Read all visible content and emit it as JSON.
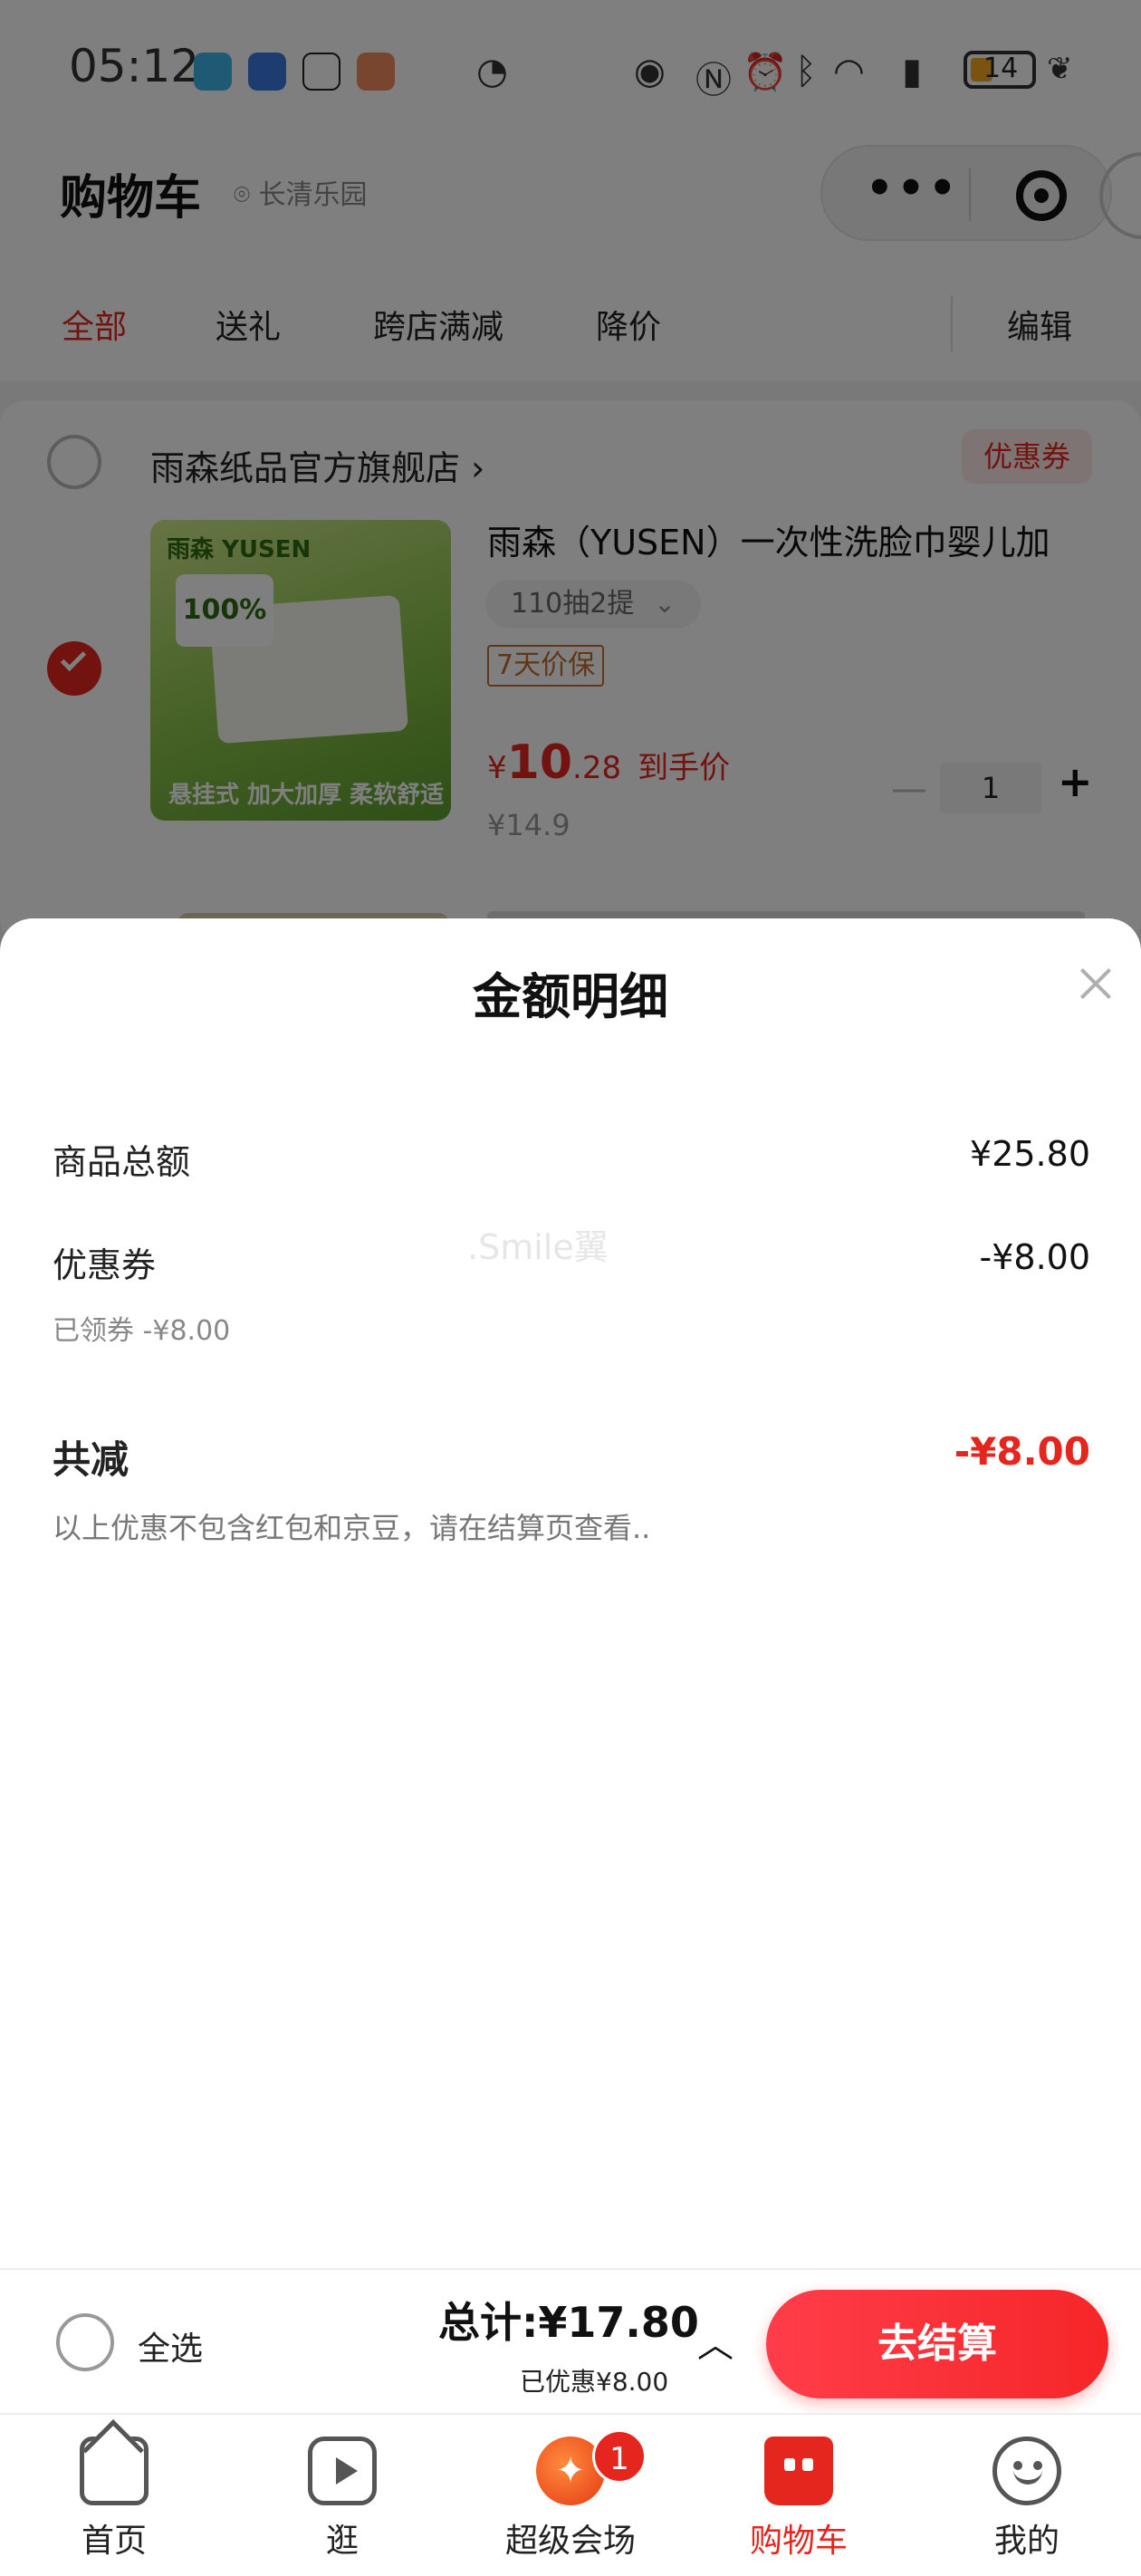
{
  "status_bar": {
    "time": "05:12",
    "battery": "14"
  },
  "header": {
    "title": "购物车",
    "location": "长清乐园"
  },
  "tabs": [
    "全部",
    "送礼",
    "跨店满减",
    "降价"
  ],
  "tabs_edit": "编辑",
  "store": {
    "name": "雨森纸品官方旗舰店 ›",
    "coupon_tag": "优惠券"
  },
  "product": {
    "title": "雨森（YUSEN）一次性洗脸巾婴儿加",
    "sku": "110抽2提",
    "protect_tag": "7天价保",
    "price_symbol": "¥",
    "price_int": "10",
    "price_dec": ".28",
    "price_label": "到手价",
    "original_price": "¥14.9",
    "quantity": "1",
    "image_text": {
      "brand": "雨森 YUSEN",
      "percent": "100%",
      "footer": "悬挂式   加大加厚 柔软舒适"
    }
  },
  "sheet": {
    "title": "金额明细",
    "rows": [
      {
        "label": "商品总额",
        "value": "¥25.80"
      },
      {
        "label": "优惠券",
        "value": "-¥8.00",
        "sub": "已领券 -¥8.00"
      }
    ],
    "total_reduction": {
      "label": "共减",
      "value": "-¥8.00"
    },
    "note": "以上优惠不包含红包和京豆，请在结算页查看..",
    "watermark": ".Smile翼"
  },
  "checkout": {
    "select_all": "全选",
    "total_label": "总计:",
    "total_value": "¥17.80",
    "saved": "已优惠¥8.00",
    "pay_button": "去结算"
  },
  "bottom_nav": [
    {
      "label": "首页",
      "icon": "home-icon"
    },
    {
      "label": "逛",
      "icon": "video-icon"
    },
    {
      "label": "超级会场",
      "icon": "venue-icon",
      "badge": "1"
    },
    {
      "label": "购物车",
      "icon": "cart-icon",
      "active": true
    },
    {
      "label": "我的",
      "icon": "profile-icon"
    }
  ],
  "colors": {
    "accent": "#e4261f",
    "mask": "rgba(0,0,0,0.5)"
  }
}
